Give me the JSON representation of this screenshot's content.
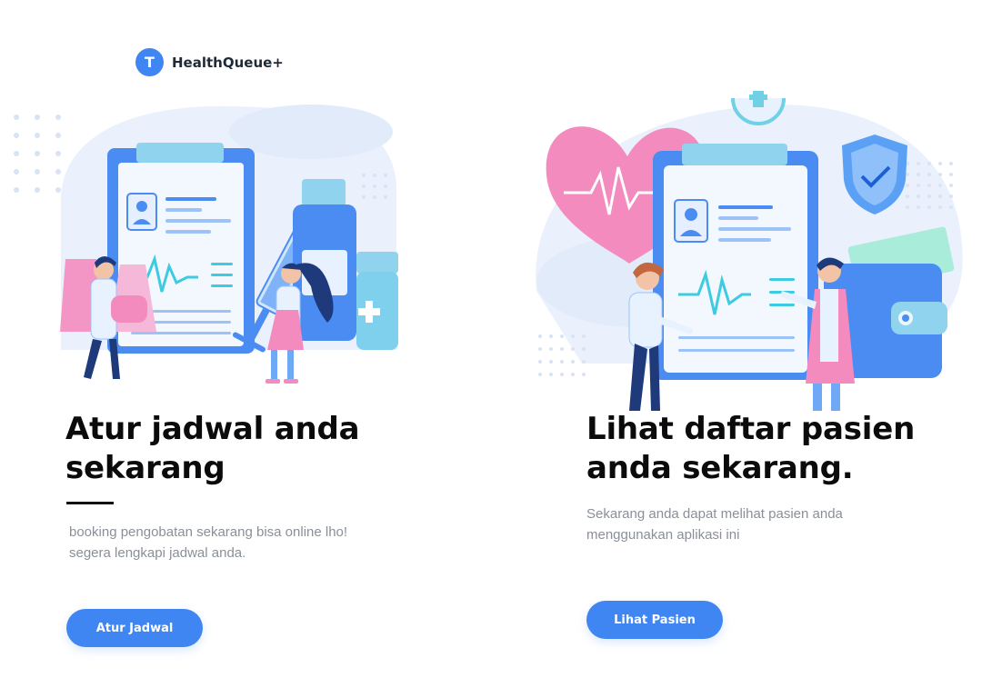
{
  "header": {
    "logo_letter": "T",
    "app_name": "HealthQueue+"
  },
  "cards": [
    {
      "title_line1": "Atur jadwal anda",
      "title_line2": "sekarang",
      "description_line1": "booking pengobatan sekarang bisa online lho!",
      "description_line2": "segera lengkapi jadwal anda.",
      "button_label": "Atur Jadwal"
    },
    {
      "title_line1": "Lihat daftar pasien",
      "title_line2": "anda sekarang.",
      "description_line1": "Sekarang anda dapat melihat pasien anda",
      "description_line2": "menggunakan aplikasi ini",
      "button_label": "Lihat Pasien"
    }
  ],
  "colors": {
    "accent": "#3f86f2",
    "heading": "#0b0b0b",
    "muted_text": "#8a8f99",
    "illustration_blue": "#6fa8f5",
    "illustration_pink": "#f48bbf",
    "illustration_bg": "#e8f0fc"
  },
  "icons": [
    "logo-badge",
    "patient-avatar-icon",
    "heartbeat-icon",
    "medicine-bottle-icon",
    "syringe-icon",
    "heart-icon",
    "shield-check-icon",
    "wallet-icon",
    "plus-badge-icon"
  ]
}
